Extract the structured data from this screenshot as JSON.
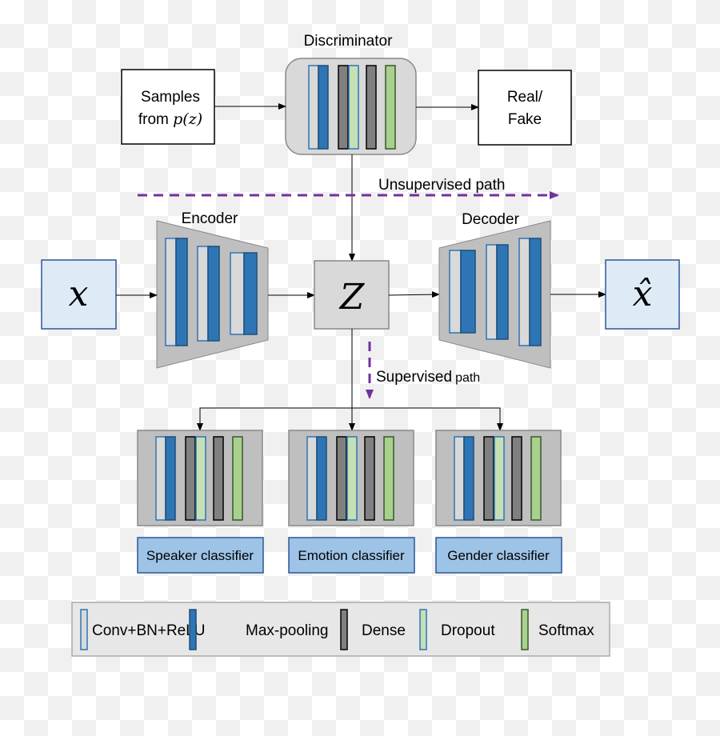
{
  "discriminator": {
    "title": "Discriminator",
    "layers": [
      "conv",
      "maxpool",
      "dense",
      "dropout",
      "dense",
      "softmax"
    ]
  },
  "samples": {
    "line1": "Samples",
    "line2": "from ",
    "math": "p(z)"
  },
  "output": {
    "line1": "Real/",
    "line2": "Fake"
  },
  "unsupervised_label": "Unsupervised path",
  "supervised_label": "Supervised",
  "supervised_label_small": "path",
  "encoder": {
    "title": "Encoder",
    "layers": [
      "conv+maxpool",
      "conv+maxpool",
      "conv+maxpool"
    ]
  },
  "decoder": {
    "title": "Decoder",
    "layers": [
      "conv+maxpool",
      "conv+maxpool",
      "conv+maxpool"
    ]
  },
  "input_symbol": "x",
  "latent_symbol": "Z",
  "output_symbol": "x̂",
  "classifiers": [
    {
      "label": "Speaker classifier",
      "layers": [
        "conv",
        "maxpool",
        "dense",
        "dropout",
        "dense",
        "softmax"
      ]
    },
    {
      "label": "Emotion classifier",
      "layers": [
        "conv",
        "maxpool",
        "dense",
        "dropout",
        "dense",
        "softmax"
      ]
    },
    {
      "label": "Gender classifier",
      "layers": [
        "conv",
        "maxpool",
        "dense",
        "dropout",
        "dense",
        "softmax"
      ]
    }
  ],
  "legend": [
    {
      "type": "conv",
      "label": "Conv+BN+ReLU"
    },
    {
      "type": "maxpool",
      "label": "Max-pooling"
    },
    {
      "type": "dense",
      "label": "Dense"
    },
    {
      "type": "dropout",
      "label": "Dropout"
    },
    {
      "type": "softmax",
      "label": "Softmax"
    }
  ],
  "colors": {
    "conv": "#d9d9d9",
    "maxpool": "#2e75b6",
    "dense": "#808080",
    "dropout": "#c5e0b4",
    "softmax": "#a9d18e",
    "path_arrow": "#7030a0",
    "input_box": "#deebf7",
    "classifier_label": "#9dc3e6"
  }
}
